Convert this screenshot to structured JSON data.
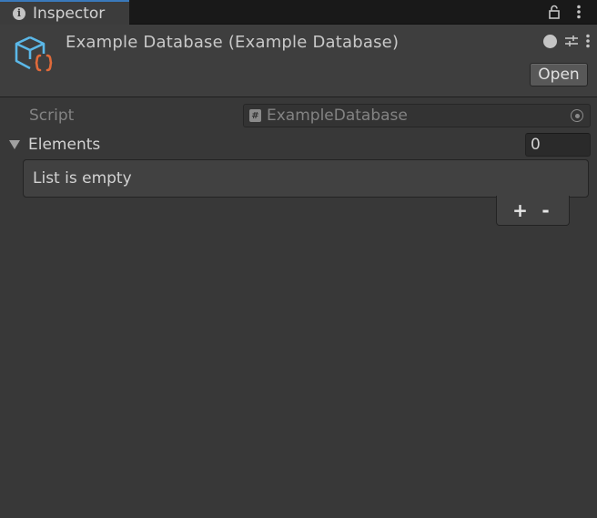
{
  "tab": {
    "title": "Inspector",
    "icon": "info-icon"
  },
  "header": {
    "title": "Example Database (Example Database)",
    "open_label": "Open",
    "help_glyph": "?"
  },
  "properties": {
    "script": {
      "label": "Script",
      "value": "ExampleDatabase",
      "icon_glyph": "#"
    },
    "elements": {
      "label": "Elements",
      "size": "0",
      "empty_text": "List is empty",
      "add_label": "+",
      "remove_label": "-"
    }
  },
  "colors": {
    "accent": "#3a79bb",
    "icon_blue": "#5bb8e8",
    "icon_orange": "#e06a3a"
  }
}
